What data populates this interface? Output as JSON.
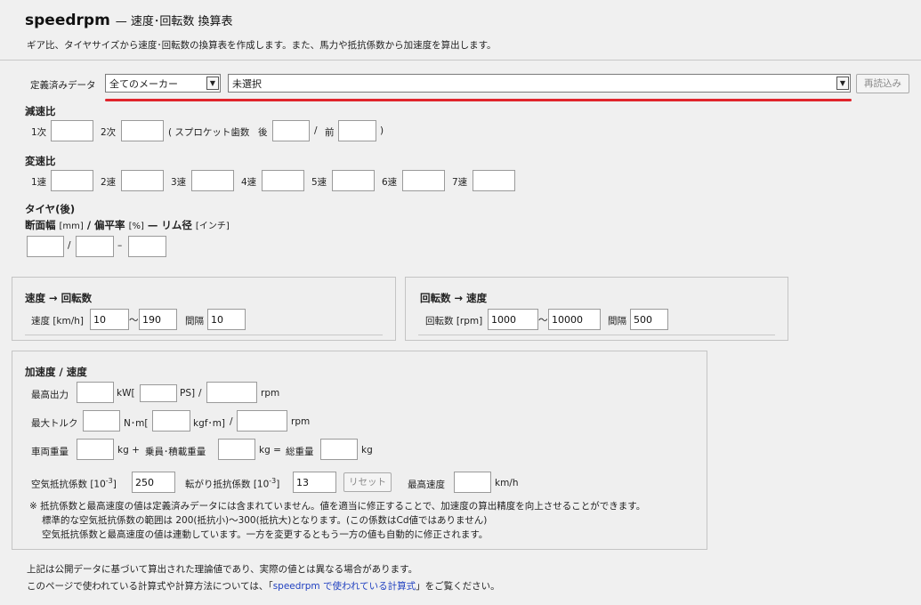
{
  "header": {
    "app_name": "speedrpm",
    "subtitle": "— 速度･回転数 換算表",
    "description": "ギア比、タイヤサイズから速度･回転数の換算表を作成します。また、馬力や抵抗係数から加速度を算出します。"
  },
  "preset": {
    "label": "定義済みデータ",
    "maker_value": "全てのメーカー",
    "model_value": "未選択",
    "reload_label": "再読込み",
    "highlight_color": "#e0242c"
  },
  "reduction": {
    "title": "減速比",
    "primary_label": "1次",
    "secondary_label": "2次",
    "sprocket_open": "( スプロケット歯数",
    "rear_label": "後",
    "slash": "/",
    "front_label": "前",
    "close": ")"
  },
  "gear": {
    "title": "変速比",
    "labels": [
      "1速",
      "2速",
      "3速",
      "4速",
      "5速",
      "6速",
      "7速"
    ]
  },
  "tire": {
    "title": "タイヤ(後)",
    "width_label": "断面幅",
    "width_unit": "[mm]",
    "sep1": "/",
    "ratio_label": "偏平率",
    "ratio_unit": "[%]",
    "sep2": "—",
    "rim_label": "リム径",
    "rim_unit": "[インチ]",
    "input_slash": "/",
    "input_dash": "–"
  },
  "speed_to_rpm": {
    "title": "速度 → 回転数",
    "speed_label": "速度 [km/h]",
    "from": "10",
    "tilde": "〜",
    "to": "190",
    "interval_label": "間隔",
    "interval": "10"
  },
  "rpm_to_speed": {
    "title": "回転数 → 速度",
    "rpm_label": "回転数 [rpm]",
    "from": "1000",
    "tilde": "〜",
    "to": "10000",
    "interval_label": "間隔",
    "interval": "500"
  },
  "accel": {
    "title": "加速度 / 速度",
    "max_power_label": "最高出力",
    "kw_label": "kW[",
    "ps_label": "PS]",
    "power_slash": "/",
    "power_rpm": "rpm",
    "max_torque_label": "最大トルク",
    "nm_label": "N･m[",
    "kgfm_label": "kgf･m]",
    "torque_slash": "/",
    "torque_rpm": "rpm",
    "vehicle_weight_label": "車両重量",
    "kg1": "kg +",
    "rider_weight_label": "乗員･積載重量",
    "kg2": "kg =",
    "total_weight_label": "総重量",
    "kg3": "kg",
    "air_label": "空気抵抗係数 [10",
    "air_exp": "-3",
    "air_close": "]",
    "air_value": "250",
    "roll_label": "転がり抵抗係数 [10",
    "roll_exp": "-3",
    "roll_close": "]",
    "roll_value": "13",
    "reset_label": "リセット",
    "top_speed_label": "最高速度",
    "top_speed_unit": "km/h",
    "notes": [
      "※ 抵抗係数と最高速度の値は定義済みデータには含まれていません。値を適当に修正することで、加速度の算出精度を向上させることができます。",
      "標準的な空気抵抗係数の範囲は 200(抵抗小)〜300(抵抗大)となります。(この係数はCd値ではありません)",
      "空気抵抗係数と最高速度の値は連動しています。一方を変更するともう一方の値も自動的に修正されます。"
    ]
  },
  "footer": {
    "line1": "上記は公開データに基づいて算出された理論値であり、実際の値とは異なる場合があります。",
    "line2_pre": "このページで使われている計算式や計算方法については、「",
    "line2_link": "speedrpm で使われている計算式",
    "line2_post": "」をご覧ください。"
  }
}
